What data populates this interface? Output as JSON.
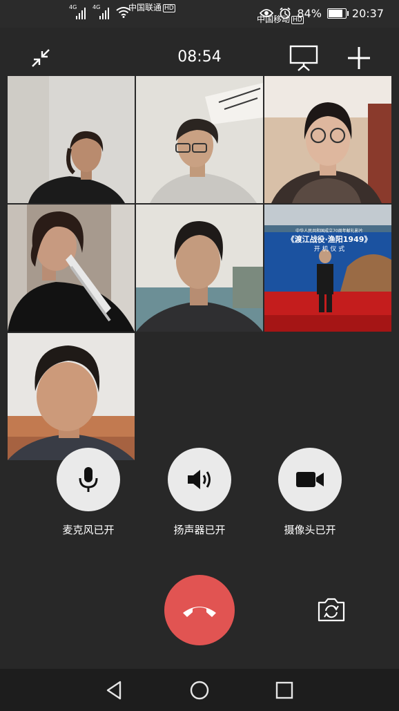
{
  "status_bar": {
    "carrier1": "中国联通",
    "carrier2": "中国移动",
    "hd_badge": "HD",
    "network_type": "4G",
    "battery_percent": "84%",
    "battery_level": 0.84,
    "time": "20:37",
    "icons": [
      "eye-icon",
      "alarm-icon",
      "battery-icon",
      "wifi-icon",
      "signal-icon"
    ]
  },
  "header": {
    "call_duration": "08:54",
    "icons": [
      "minimize-icon",
      "screen-share-icon",
      "add-participant-icon"
    ]
  },
  "video_grid": {
    "participants": 7,
    "banner": {
      "line1": "中华人民共和国成立70周年献礼影片",
      "line2": "《渡江战役·渔阳1949》",
      "line3": "开 机 仪 式"
    }
  },
  "controls": {
    "mic_label": "麦克风已开",
    "speaker_label": "扬声器已开",
    "camera_label": "摄像头已开"
  },
  "actions": {
    "icons": [
      "hang-up-icon",
      "switch-camera-icon"
    ]
  },
  "navigation": {
    "icons": [
      "back-icon",
      "home-icon",
      "recents-icon"
    ]
  },
  "colors": {
    "background": "#282828",
    "hang_up": "#e15452",
    "control_button": "#eaeaea"
  }
}
